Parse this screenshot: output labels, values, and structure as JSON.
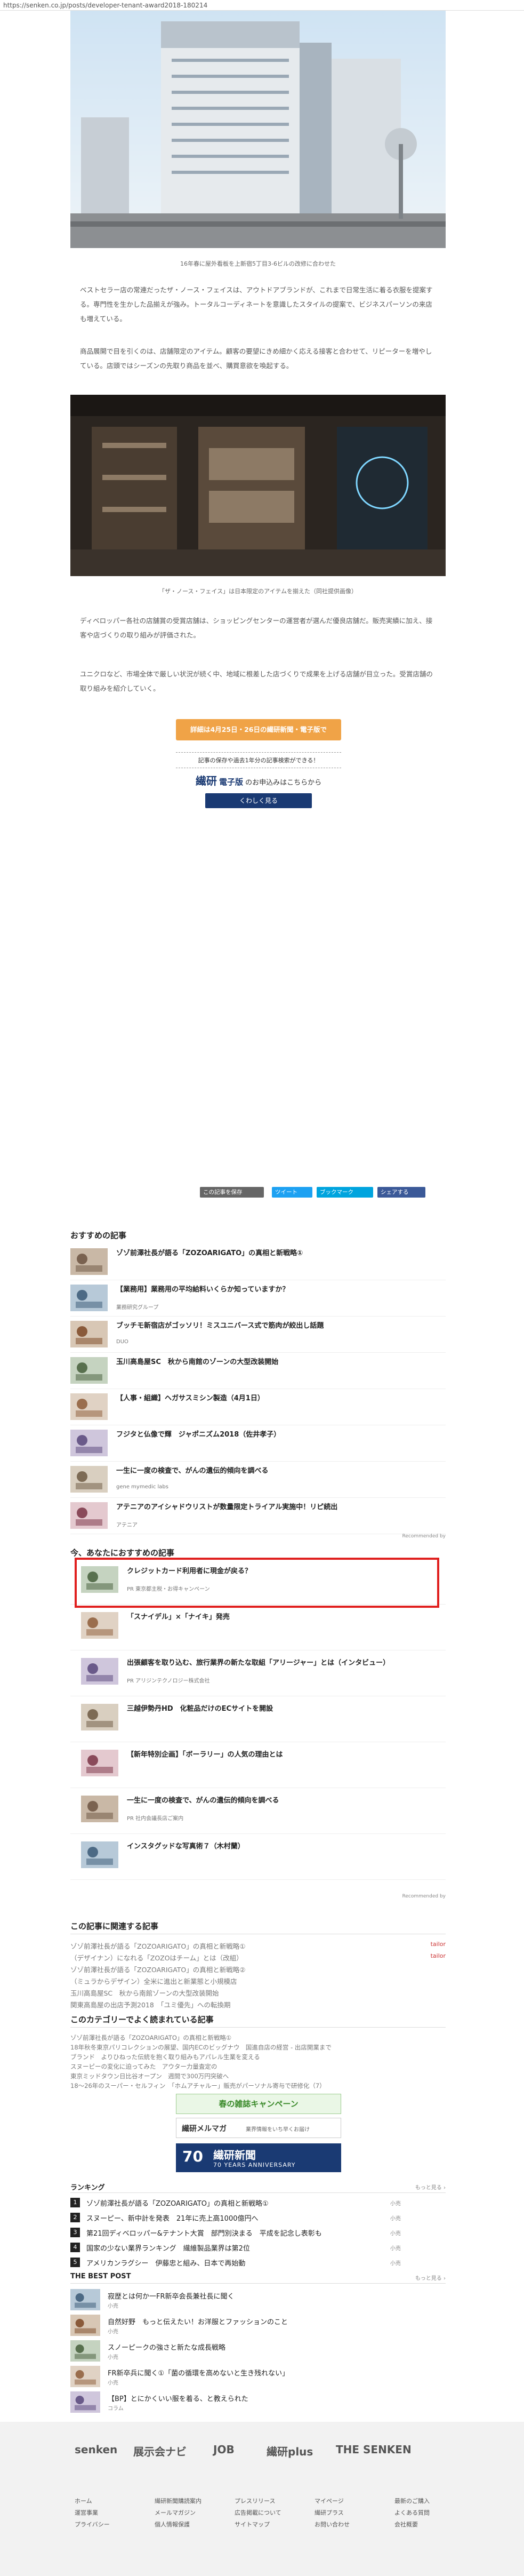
{
  "url": "https://senken.co.jp/posts/developer-tenant-award2018-180214",
  "captions": {
    "photo1": "16年春に屋外看板を上新宿5丁目3-6ビルの改修に合わせた",
    "photo2": "「ザ・ノース・フェイス」は日本限定のアイテムを揃えた（同社提供画像）"
  },
  "paragraphs": [
    "ベストセラー店の常連だったザ・ノース・フェイスは、アウトドアブランドが、これまで日常生活に着る衣服を提案する。専門性を生かした品揃えが強み。トータルコーディネートを意識したスタイルの提案で、ビジネスパーソンの来店も増えている。",
    "商品展開で目を引くのは、店舗限定のアイテム。顧客の要望にきめ細かく応える接客と合わせて、リピーターを増やしている。店頭ではシーズンの先取り商品を並べ、購買意欲を喚起する。",
    "ディベロッパー各社の店舗賞の受賞店舗は、ショッピングセンターの運営者が選んだ優良店舗だ。販売実績に加え、接客や店づくりの取り組みが評価された。",
    "ユニクロなど、市場全体で厳しい状況が続く中、地域に根差した店づくりで成果を上げる店舗が目立った。受賞店舗の取り組みを紹介していく。"
  ],
  "cta_label": "詳細は4月25日・26日の繊研新聞・電子版で",
  "banner": {
    "lead": "記事の保存や過去1年分の記事検索ができる！",
    "brand": "繊研",
    "brand2": "電子版",
    "tail": "のお申込みはこちらから",
    "button": "くわしく見る"
  },
  "shares": {
    "copy": "この記事を保存",
    "tweet": "ツイート",
    "hatena": "ブックマーク",
    "fb": "シェアする"
  },
  "recommend_title": "おすすめの記事",
  "recommend": [
    {
      "title": "ゾゾ前澤社長が語る「ZOZOARIGATO」の真相と新戦略①",
      "src": ""
    },
    {
      "title": "【業務用】業務用の平均給料いくらか知っていますか？",
      "src": "業務研究グループ"
    },
    {
      "title": "ブッチモ新宿店がゴッソリ！ミスユニバース式で筋肉が絞出し話題",
      "src": "DUO"
    },
    {
      "title": "玉川高島屋SC　秋から南館のゾーンの大型改装開始",
      "src": ""
    },
    {
      "title": "【人事・組織】ヘガサスミシン製造（4月1日）",
      "src": ""
    },
    {
      "title": "フジタと仏像で輝　ジャポニズム2018（佐井孝子）",
      "src": ""
    },
    {
      "title": "一生に一度の検査で、がんの遺伝的傾向を調べる",
      "src": "gene mymedic labs"
    },
    {
      "title": "アテニアのアイシャドウリストが数量限定トライアル実施中！リピ続出",
      "src": "アテニア"
    }
  ],
  "recommended_by": "Recommended by",
  "also_title": "今、あなたにおすすめの記事",
  "also": [
    {
      "title": "クレジットカード利用者に現金が戻る？",
      "src": "PR  東京都主税・お得キャンペーン"
    },
    {
      "title": "「スナイデル」×「ナイキ」発売",
      "src": ""
    },
    {
      "title": "出張顧客を取り込む、旅行業界の新たな取組「アリージャー」とは（インタビュー）",
      "src": "PR  アリジンテクノロジー株式会社"
    },
    {
      "title": "三越伊勢丹HD　化粧品だけのECサイトを開設",
      "src": ""
    },
    {
      "title": "【新年特別企画】「ボーラリー」の人気の理由とは",
      "src": ""
    },
    {
      "title": "一生に一度の検査で、がんの遺伝的傾向を調べる",
      "src": "PR  社内会議長店ご案内"
    },
    {
      "title": "インスタグッドな写真術７（木村蘭）",
      "src": ""
    }
  ],
  "recommended_by2": "Recommended by",
  "related_title": "この記事に関連する記事",
  "related": [
    {
      "text": "ゾゾ前澤社長が語る「ZOZOARIGATO」の真相と新戦略①",
      "label": "tailor"
    },
    {
      "text": "（デザイナン）になれる「ZOZOはチーム」とは（改組）",
      "label": "tailor"
    },
    {
      "text": "ゾゾ前澤社長が語る「ZOZOARIGATO」の真相と新戦略②",
      "label": ""
    },
    {
      "text": "（ミュラからデザイン）全米に進出と新業態と小規模店",
      "label": ""
    },
    {
      "text": "玉川高島屋SC　秋から南館ゾーンの大型改装開始",
      "label": ""
    },
    {
      "text": "関東高島屋の出店予測2018　「ユミ優先」への転換期",
      "label": ""
    }
  ],
  "category_title": "このカテゴリーでよく読まれている記事",
  "category": [
    "ゾゾ前澤社長が語る「ZOZOARIGATO」の真相と新戦略①",
    "18年秋冬東京パリコレクションの展望、国内ECのビッグナウ　国進自店の経営 - 出店開業まで",
    "ブランド　よりひねった伝統を抱く取り組みもアパレル生業を変える",
    "スヌーピーの変化に迫ってみた　アウター力量査定の",
    "東京ミッドタウン日比谷オープン　週間で300万円突破へ",
    "18〜26年のスーパー・セルフィン　「ホムアチャルー」販売がパーソナル寄与で研修化（7）"
  ],
  "ads": {
    "spring": "春の雑誌キャンペーン",
    "mail": "繊研メルマガ",
    "mail_sub": "業界情報をいち早くお届け",
    "anniv_num": "70",
    "anniv_brand": "繊研新聞",
    "anniv_sub": "70 YEARS ANNIVERSARY"
  },
  "ranking_title": "ランキング",
  "ranking_more": "もっと見る ›",
  "ranking": [
    {
      "num": "1",
      "title": "ゾゾ前澤社長が語る「ZOZOARIGATO」の真相と新戦略①",
      "sub": "小売"
    },
    {
      "num": "2",
      "title": "スヌーピー、新中計を発表　21年に売上高1000億円へ",
      "sub": "小売"
    },
    {
      "num": "3",
      "title": "第21回ディベロッパー&テナント大賞　部門別決まる　平成を記念し表彰も",
      "sub": "小売"
    },
    {
      "num": "4",
      "title": "国家の少ない業界ランキング　繊維製品業界は第2位",
      "sub": "小売"
    },
    {
      "num": "5",
      "title": "アメリカンラグシー　伊藤忠と組み、日本で再始動",
      "sub": "小売"
    }
  ],
  "best_title": "THE BEST POST",
  "best_more": "もっと見る ›",
  "best": [
    {
      "title": "寂歴とは何か一FR新卒会長兼社長に聞く",
      "sub": "小売"
    },
    {
      "title": "自然好野　もっと伝えたい！お洋服とファッションのこと",
      "sub": "小売"
    },
    {
      "title": "スノーピークの強さと新たな成長戦略",
      "sub": "小売"
    },
    {
      "title": "FR新卒兵に聞く①「菌の循環を高めないと生き残れない」",
      "sub": "小売"
    },
    {
      "title": "【BP】とにかくいい服を着る、と教えられた",
      "sub": "コラム"
    }
  ],
  "footer_logos": [
    "senken",
    "展示会ナビ",
    "JOB",
    "繊研plus",
    "THE SENKEN"
  ],
  "footer_links": [
    "ホーム",
    "繊研新聞購読案内",
    "プレスリリース",
    "マイページ",
    "最新のご購入",
    "運営事業",
    "メールマガジン",
    "広告掲載について",
    "繊研プラス",
    "よくある質問",
    "プライバシー",
    "個人情報保護",
    "サイトマップ",
    "お問い合わせ",
    "会社概要"
  ]
}
